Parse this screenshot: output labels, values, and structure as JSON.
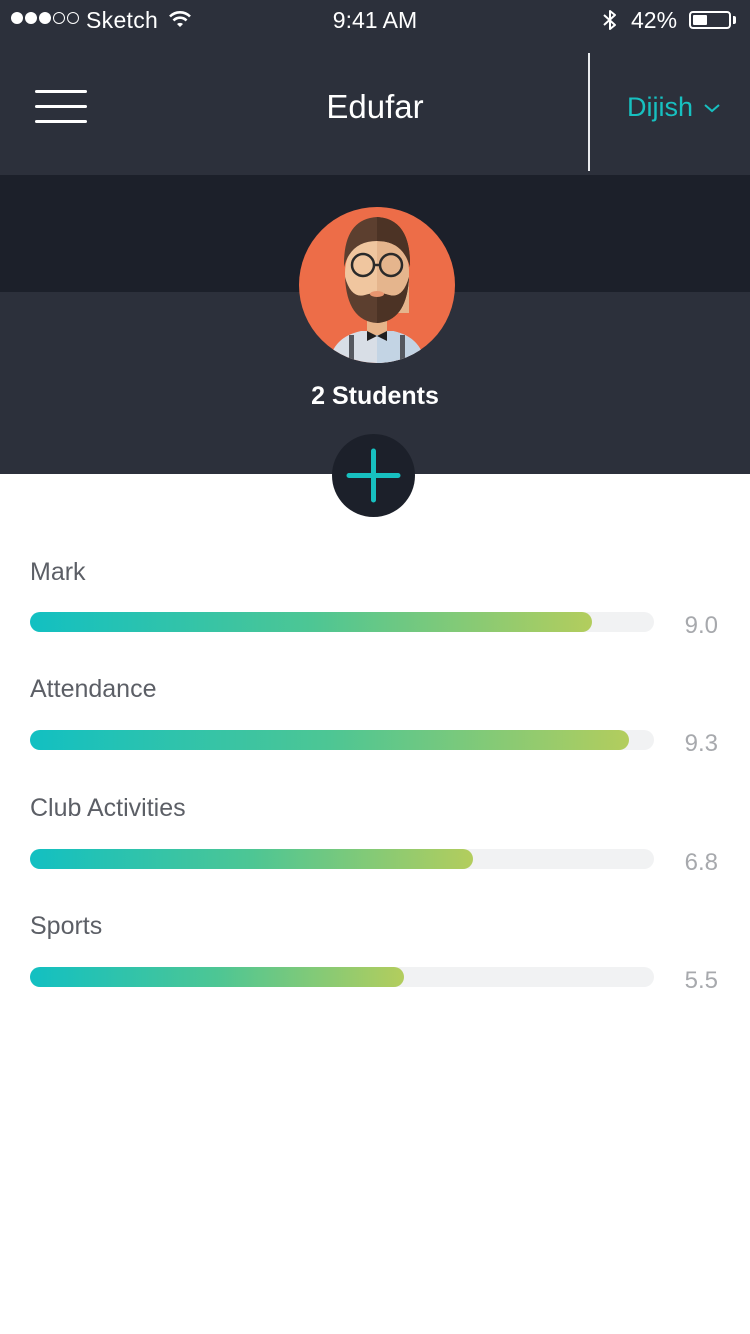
{
  "status_bar": {
    "carrier": "Sketch",
    "time": "9:41 AM",
    "battery_percent": "42%",
    "battery_level": 0.42,
    "signal_bars_filled": 3,
    "signal_bars_total": 5
  },
  "nav": {
    "title": "Edufar",
    "menu_icon": "hamburger-menu-icon",
    "user_name": "Dijish",
    "user_menu_icon": "chevron-down-icon"
  },
  "hero": {
    "avatar_icon": "bearded-man-avatar",
    "students_label": "2 Students",
    "add_icon": "plus-icon"
  },
  "metrics": [
    {
      "label": "Mark",
      "value": "9.0",
      "progress": 0.9
    },
    {
      "label": "Attendance",
      "value": "9.3",
      "progress": 0.96
    },
    {
      "label": "Club Activities",
      "value": "6.8",
      "progress": 0.71
    },
    {
      "label": "Sports",
      "value": "5.5",
      "progress": 0.6
    }
  ],
  "colors": {
    "header_bg": "#2c303b",
    "hero_band_bg": "#1c202a",
    "accent": "#17c0c0",
    "gradient_start": "#12c0c2",
    "gradient_end": "#b3cd5d",
    "avatar_bg": "#ed6d48"
  }
}
